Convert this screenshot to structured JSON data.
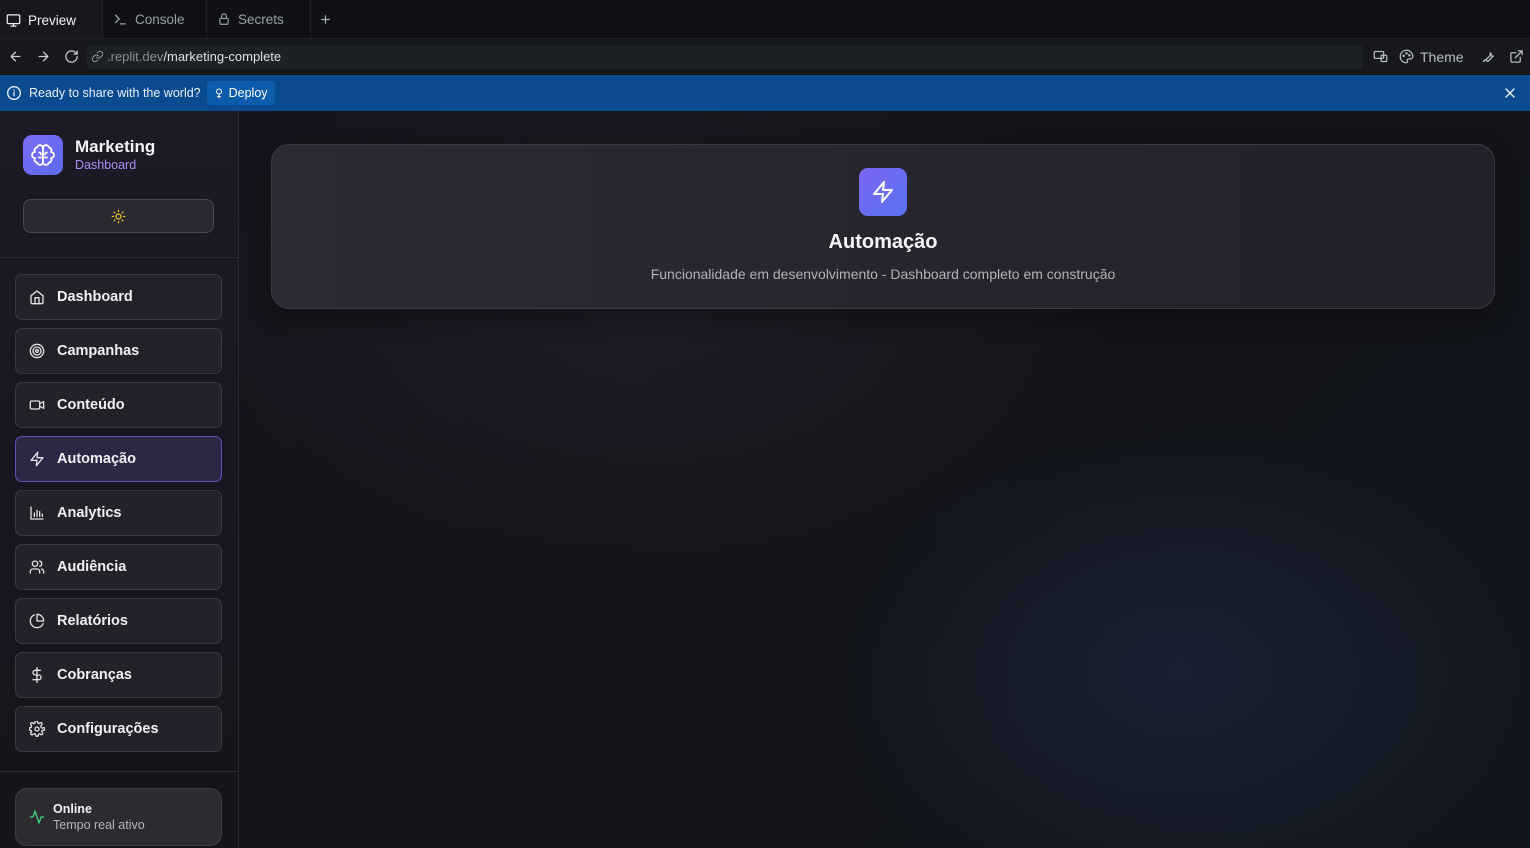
{
  "tabs": [
    {
      "label": "Preview",
      "icon": "monitor-icon",
      "active": true
    },
    {
      "label": "Console",
      "icon": "terminal-icon",
      "active": false
    },
    {
      "label": "Secrets",
      "icon": "lock-icon",
      "active": false
    }
  ],
  "address": {
    "host": ".replit.dev",
    "path": "/marketing-complete",
    "theme_label": "Theme"
  },
  "banner": {
    "message": "Ready to share with the world?",
    "deploy_label": "Deploy"
  },
  "sidebar": {
    "brand_title": "Marketing",
    "brand_subtitle": "Dashboard",
    "items": [
      {
        "label": "Dashboard",
        "icon": "home-icon"
      },
      {
        "label": "Campanhas",
        "icon": "target-icon"
      },
      {
        "label": "Conteúdo",
        "icon": "video-icon"
      },
      {
        "label": "Automação",
        "icon": "zap-icon",
        "active": true
      },
      {
        "label": "Analytics",
        "icon": "bar-chart-icon"
      },
      {
        "label": "Audiência",
        "icon": "users-icon"
      },
      {
        "label": "Relatórios",
        "icon": "pie-chart-icon"
      },
      {
        "label": "Cobranças",
        "icon": "dollar-icon"
      },
      {
        "label": "Configurações",
        "icon": "settings-icon"
      }
    ],
    "status": {
      "title": "Online",
      "subtitle": "Tempo real ativo"
    }
  },
  "main": {
    "title": "Automação",
    "subtitle": "Funcionalidade em desenvolvimento - Dashboard completo em construção"
  },
  "colors": {
    "accent": "#6d6af3",
    "brand_subtitle": "#b18cf5",
    "banner": "#0a4a8f",
    "status_ok": "#3fd37a",
    "sun": "#f2c12e"
  }
}
